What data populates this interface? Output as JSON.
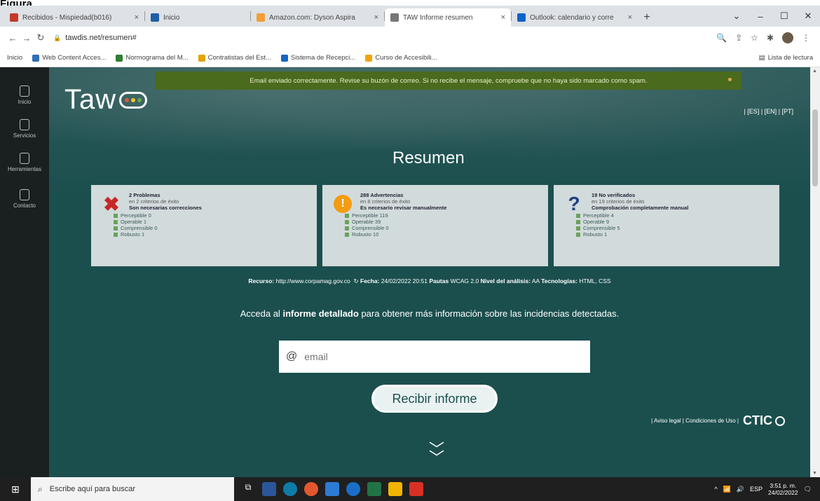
{
  "fragment_title": "Figura",
  "tabs": [
    {
      "title": "Recibidos - Mispiedad(b016)",
      "color": "#c53929",
      "active": false,
      "has_close": true
    },
    {
      "title": "Inicio",
      "color": "#1f5fa8",
      "active": false,
      "has_close": false
    },
    {
      "title": "Amazon.com: Dyson Aspira",
      "color": "#f19e38",
      "active": false,
      "has_close": true
    },
    {
      "title": "TAW Informe resumen",
      "color": "#777777",
      "active": true,
      "has_close": true
    },
    {
      "title": "Outlook: calendario y corre",
      "color": "#0a64c8",
      "active": false,
      "has_close": true
    }
  ],
  "address": {
    "url": "tawdis.net/resumen#"
  },
  "bookmarks": [
    {
      "label": "Inicio",
      "color": ""
    },
    {
      "label": "Web Content Acces...",
      "color": "#2e6fb5"
    },
    {
      "label": "Normograma del M...",
      "color": "#2e7d32"
    },
    {
      "label": "Contratistas del Est...",
      "color": "#e2a400"
    },
    {
      "label": "Sistema de Recepci...",
      "color": "#1565c0"
    },
    {
      "label": "Curso de Accesibili...",
      "color": "#f1a40b"
    }
  ],
  "reading_list": "Lista de lectura",
  "sidenav": [
    {
      "label": "Inicio"
    },
    {
      "label": "Servicios"
    },
    {
      "label": "Herramientas"
    },
    {
      "label": "Contacto"
    }
  ],
  "alert": "Email enviado correctamente. Revise su buzón de correo. Si no recibe el mensaje, compruebe que no haya sido marcado como spam.",
  "languages": "| [ES] | [EN] | [PT]",
  "title": "Resumen",
  "cards": [
    {
      "icon": "✖",
      "icon_color": "#c62828",
      "headline": "2 Problemas",
      "sub": "en 2 criterios de éxito",
      "action": "Son necesarias correcciones",
      "items": [
        "Perceptible 0",
        "Operable 1",
        "Comprensible 0",
        "Robusto 1"
      ]
    },
    {
      "icon": "!",
      "icon_color": "#f39c12",
      "headline": "288 Advertencias",
      "sub": "en 8 criterios de éxito",
      "action": "Es necesario revisar manualmente",
      "items": [
        "Perceptible 119",
        "Operable 39",
        "Comprensible 0",
        "Robusto 10"
      ]
    },
    {
      "icon": "?",
      "icon_color": "#1f3f7f",
      "headline": "19 No verificados",
      "sub": "en 19 criterios de éxito",
      "action": "Comprobación completamente manual",
      "items": [
        "Perceptible 4",
        "Operable 9",
        "Comprensible 5",
        "Robusto 1"
      ]
    }
  ],
  "infoline": {
    "recurso_label": "Recurso:",
    "recurso_value": "http://www.corpamag.gov.co",
    "fecha_label": "Fecha:",
    "fecha_value": "24/02/2022 20:51",
    "pautas_label": "Pautas",
    "pautas_value": "WCAG 2.0",
    "nivel_label": "Nivel del análisis:",
    "nivel_value": "AA",
    "tec_label": "Tecnologías:",
    "tec_value": "HTML, CSS"
  },
  "acceda": {
    "pre": "Acceda al",
    "bold": "informe detallado",
    "post": "para obtener más información sobre las incidencias detectadas."
  },
  "email": {
    "placeholder": "email"
  },
  "button_recibir": "Recibir informe",
  "legal": {
    "aviso": "| Aviso legal",
    "condiciones": "| Condiciones de Uso |",
    "brand": "CTIC"
  },
  "taskbar": {
    "search_placeholder": "Escribe aquí para buscar",
    "lang": "ESP",
    "time": "3:51 p. m.",
    "date": "24/02/2022"
  }
}
